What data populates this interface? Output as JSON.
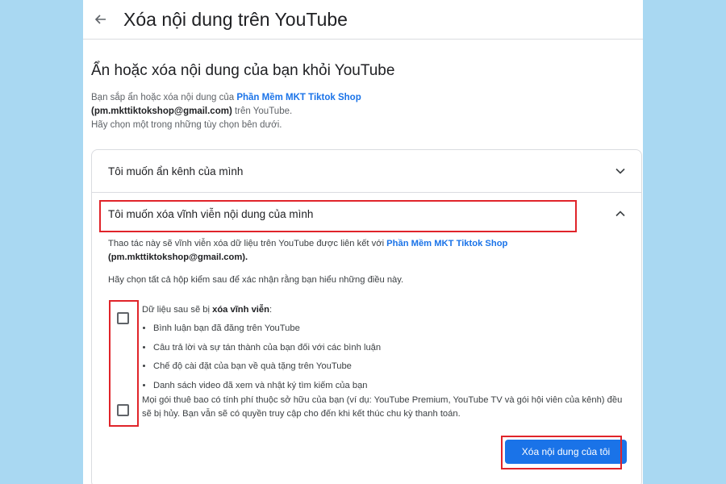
{
  "header": {
    "title": "Xóa nội dung trên YouTube"
  },
  "section": {
    "heading": "Ẩn hoặc xóa nội dung của bạn khỏi YouTube",
    "intro_prefix": "Bạn sắp ẩn hoặc xóa nội dung của ",
    "channel_name": "Phần Mềm MKT Tiktok Shop",
    "email": "(pm.mkttiktokshop@gmail.com)",
    "intro_suffix": " trên YouTube.",
    "intro_line3": "Hãy chọn một trong những tùy chọn bên dưới."
  },
  "panels": {
    "hide_title": "Tôi muốn ẩn kênh của mình",
    "delete_title": "Tôi muốn xóa vĩnh viễn nội dung của mình"
  },
  "delete_panel": {
    "desc_prefix": "Thao tác này sẽ vĩnh viễn xóa dữ liệu trên YouTube được liên kết với ",
    "channel_name": "Phần Mềm MKT Tiktok Shop",
    "email": "(pm.mkttiktokshop@gmail.com).",
    "confirm_text": "Hãy chọn tất cả hộp kiểm sau để xác nhận rằng bạn hiểu những điều này.",
    "item1_lead": "Dữ liệu sau sẽ bị ",
    "item1_bold": "xóa vĩnh viễn",
    "item1_colon": ":",
    "bullets": [
      "Bình luận bạn đã đăng trên YouTube",
      "Câu trả lời và sự tán thành của bạn đối với các bình luận",
      "Chế độ cài đặt của bạn về quà tặng trên YouTube",
      "Danh sách video đã xem và nhật ký tìm kiếm của bạn"
    ],
    "item2_text": "Mọi gói thuê bao có tính phí thuộc sở hữu của bạn (ví dụ: YouTube Premium, YouTube TV và gói hội viên của kênh) đều sẽ bị hủy. Bạn vẫn sẽ có quyền truy cập cho đến khi kết thúc chu kỳ thanh toán.",
    "button_label": "Xóa nội dung của tôi"
  },
  "icons": {
    "back": "arrow-left-icon",
    "expand": "chevron-down-icon",
    "collapse": "chevron-up-icon"
  },
  "colors": {
    "background": "#a9d8f2",
    "accent": "#1a73e8",
    "highlight": "#e0242a"
  }
}
